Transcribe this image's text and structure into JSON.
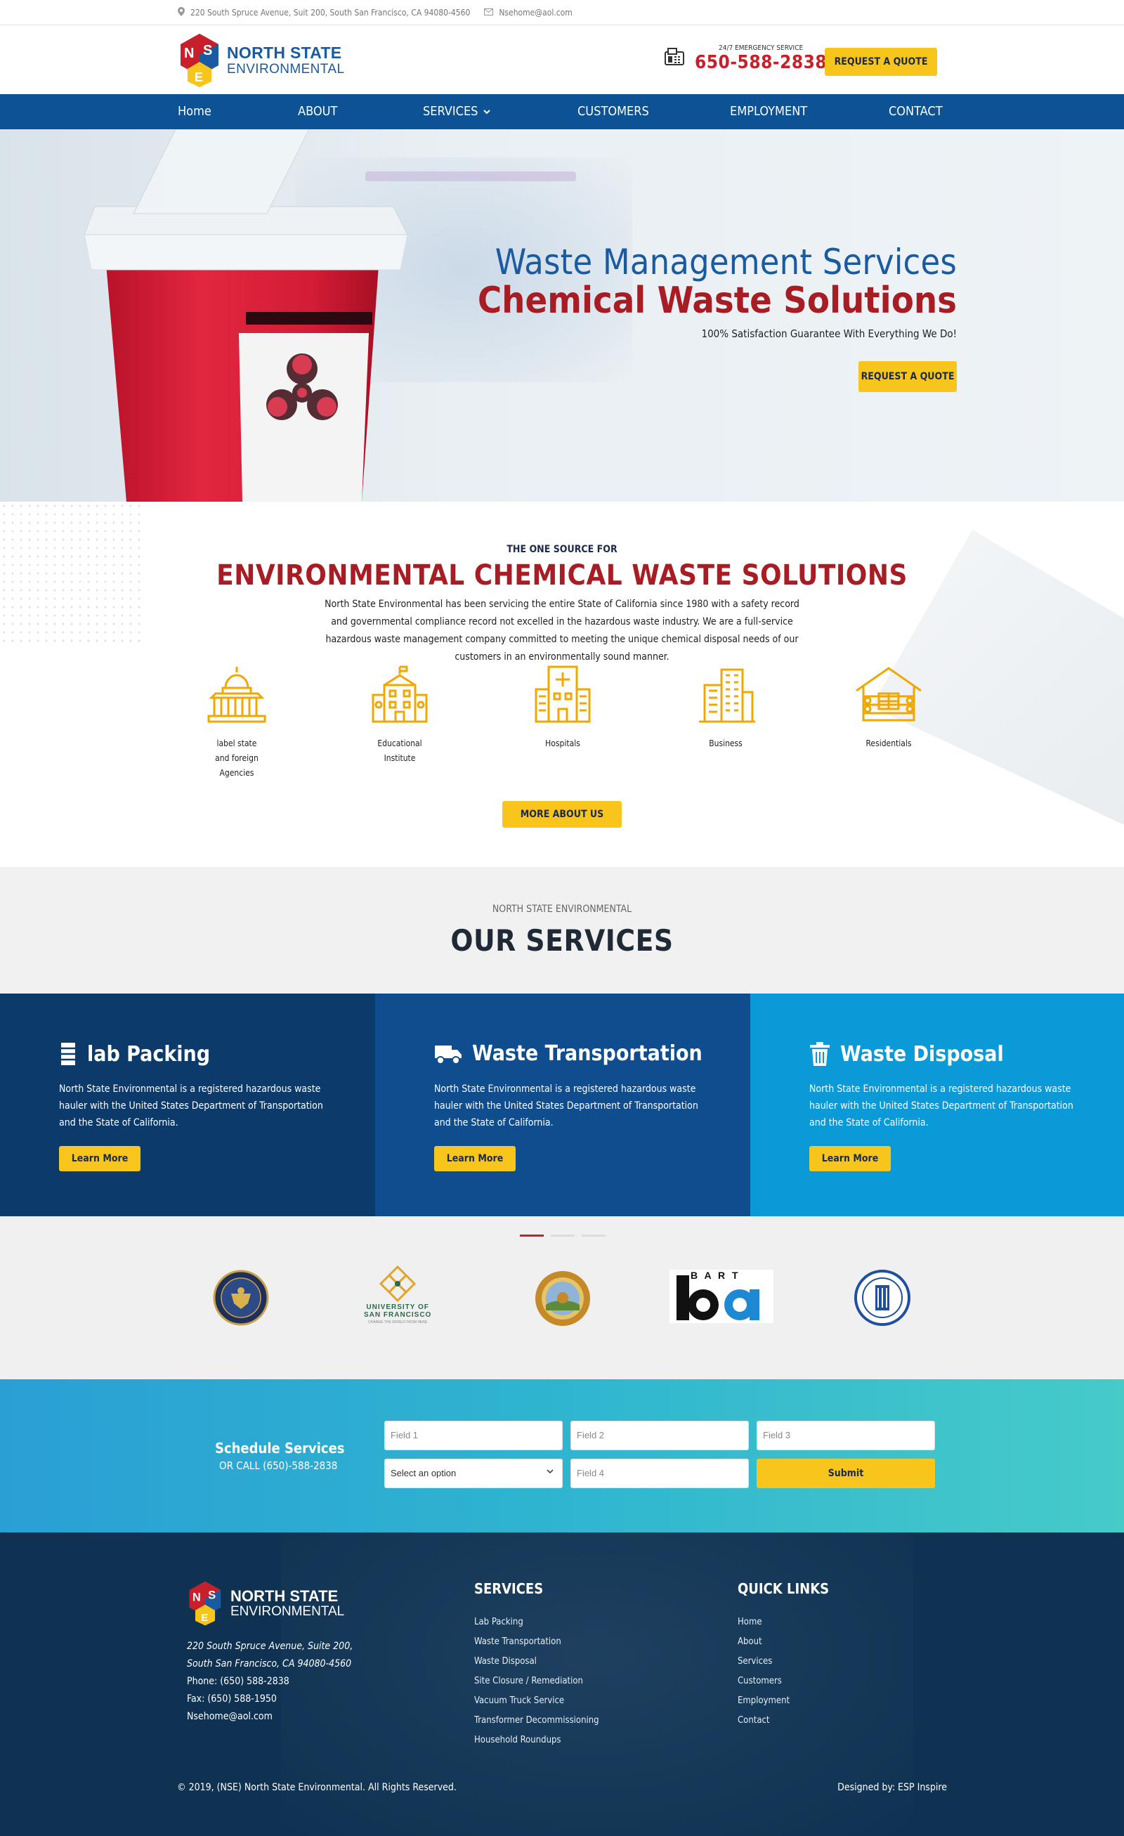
{
  "topbar": {
    "address": "220 South Spruce Avenue, Suit 200, South San Francisco, CA 94080-4560",
    "email": "Nsehome@aol.com"
  },
  "brand": {
    "name_line1": "NORTH STATE",
    "name_line2": "ENVIRONMENTAL",
    "logo_letters": [
      "N",
      "S",
      "E"
    ]
  },
  "header": {
    "emergency_label": "24/7 EMERGENCY SERVICE",
    "phone": "650-588-2838",
    "quote_button": "REQUEST A QUOTE"
  },
  "nav": {
    "items": [
      {
        "label": "Home"
      },
      {
        "label": "ABOUT"
      },
      {
        "label": "SERVICES"
      },
      {
        "label": "CUSTOMERS"
      },
      {
        "label": "EMPLOYMENT"
      },
      {
        "label": "CONTACT"
      }
    ]
  },
  "hero": {
    "title1": "Waste Management Services",
    "title2": "Chemical Waste Solutions",
    "tagline": "100% Satisfaction Guarantee With Everything We Do!",
    "button": "REQUEST A QUOTE"
  },
  "about": {
    "kicker": "THE ONE SOURCE FOR",
    "heading": "ENVIRONMENTAL CHEMICAL WASTE SOLUTIONS",
    "paragraph": "North State Environmental has been servicing the entire State of California since 1980 with a safety record and governmental compliance record not excelled in the hazardous waste industry. We are a full-service hazardous waste management company committed to meeting the unique chemical disposal needs of our customers in an environmentally sound manner.",
    "features": [
      {
        "line1": "label state",
        "line2": "and foreign",
        "line3": "Agencies",
        "icon": "capitol-icon"
      },
      {
        "line1": "Educational",
        "line2": "Institute",
        "line3": "",
        "icon": "school-icon"
      },
      {
        "line1": "Hospitals",
        "line2": "",
        "line3": "",
        "icon": "hospital-icon"
      },
      {
        "line1": "Business",
        "line2": "",
        "line3": "",
        "icon": "office-building-icon"
      },
      {
        "line1": "Residentials",
        "line2": "",
        "line3": "",
        "icon": "house-icon"
      }
    ],
    "button": "MORE ABOUT US"
  },
  "services": {
    "kicker": "NORTH STATE ENVIRONMENTAL",
    "heading": "OUR SERVICES",
    "cards": [
      {
        "title": "lab Packing",
        "text": "North State Environmental is a registered hazardous waste hauler with the United States Department of Transportation and the State of California.",
        "button": "Learn More",
        "color": "#0c3b6b",
        "icon": "barrel-icon"
      },
      {
        "title": "Waste Transportation",
        "text": "North State Environmental is a registered hazardous waste hauler with the United States Department of Transportation and the State of California.",
        "button": "Learn More",
        "color": "#0f4d8f",
        "icon": "truck-icon"
      },
      {
        "title": "Waste Disposal",
        "text": "North State Environmental is a registered hazardous waste hauler with the United States Department of Transportation and the State of California.",
        "button": "Learn More",
        "color": "#0a9ad8",
        "icon": "trash-icon"
      }
    ]
  },
  "partners": {
    "usf_line1": "UNIVERSITY OF",
    "usf_line2": "SAN FRANCISCO",
    "usf_tag": "CHANGE THE WORLD FROM HERE",
    "bart_top": "B A R T",
    "bart_mark": "ba"
  },
  "schedule": {
    "title": "Schedule Services",
    "call": "OR CALL (650)-588-2838",
    "field1": "Field 1",
    "field2": "Field 2",
    "field3": "Field 3",
    "select": "Select an option",
    "field4": "Field 4",
    "submit": "Submit"
  },
  "footer": {
    "address1": "220 South Spruce Avenue, Suite 200,",
    "address2": "South San Francisco, CA 94080-4560",
    "phone": "Phone: (650) 588-2838",
    "fax": "Fax: (650) 588-1950",
    "email": "Nsehome@aol.com",
    "services_heading": "SERVICES",
    "services": [
      "Lab Packing",
      "Waste Transportation",
      "Waste Disposal",
      "Site Closure / Remediation",
      "Vacuum Truck Service",
      "Transformer Decommissioning",
      "Household Roundups"
    ],
    "links_heading": "QUICK LINKS",
    "links": [
      "Home",
      "About",
      "Services",
      "Customers",
      "Employment",
      "Contact"
    ],
    "copyright": "© 2019, (NSE) North State Environmental. All Rights Reserved.",
    "designed": "Designed by: ESP Inspire"
  },
  "colors": {
    "nav_blue": "#0d5294",
    "brand_red": "#a81c23",
    "accent_yellow": "#f7c51b",
    "footer_navy": "#0f3252"
  }
}
